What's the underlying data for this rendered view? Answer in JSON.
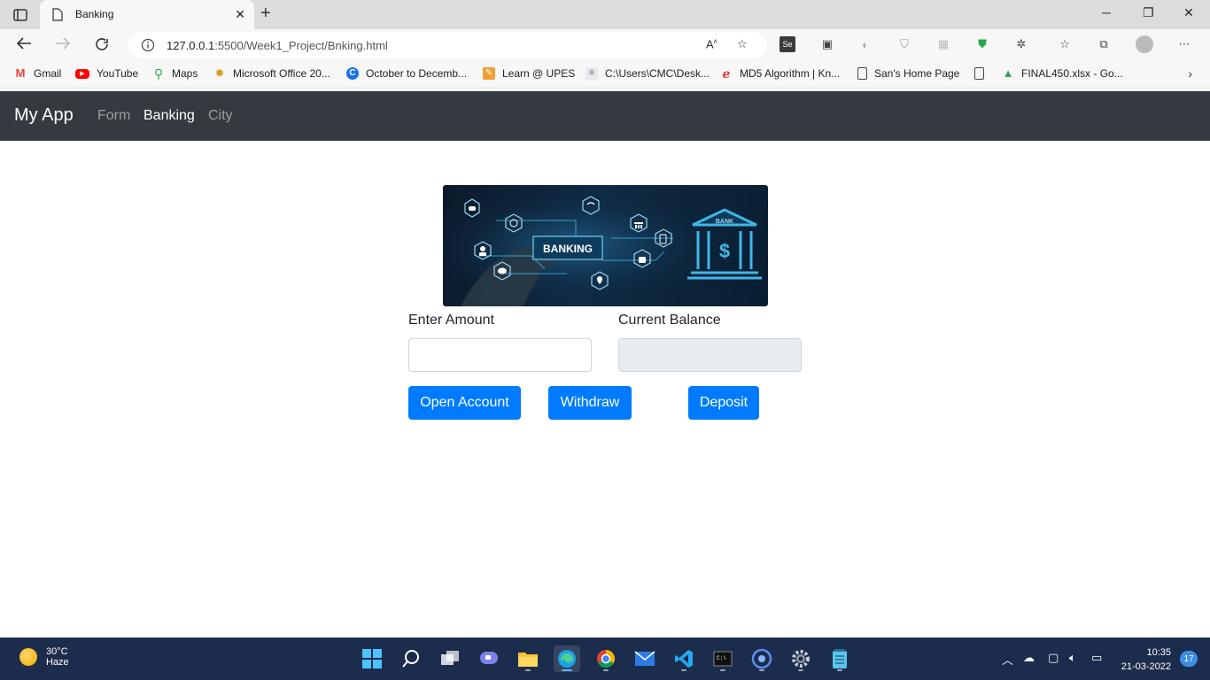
{
  "browser": {
    "tab_title": "Banking",
    "url_host": "127.0.0.1",
    "url_path": ":5500/Week1_Project/Bnking.html",
    "bookmarks": [
      {
        "label": "Gmail",
        "color": "#ea4335"
      },
      {
        "label": "YouTube",
        "color": "#ff0000"
      },
      {
        "label": "Maps",
        "color": "#34a853"
      },
      {
        "label": "Microsoft Office 20...",
        "color": "#d4a017"
      },
      {
        "label": "October to Decemb...",
        "color": "#1a73e8"
      },
      {
        "label": "Learn @ UPES",
        "color": "#f0a030"
      },
      {
        "label": "C:\\Users\\CMC\\Desk...",
        "color": "#9aa0a6"
      },
      {
        "label": "MD5 Algorithm | Kn...",
        "color": "#e53935"
      },
      {
        "label": "San's Home Page",
        "color": "#ffffff"
      },
      {
        "label": "",
        "color": "#ffffff"
      },
      {
        "label": "FINAL450.xlsx - Go...",
        "color": "#34a853"
      }
    ]
  },
  "app": {
    "brand": "My App",
    "nav": [
      {
        "label": "Form",
        "active": false
      },
      {
        "label": "Banking",
        "active": true
      },
      {
        "label": "City",
        "active": false
      }
    ],
    "banner": {
      "main_label": "BANKING",
      "bank_label": "BANK",
      "currency_symbol": "$"
    },
    "amount_label": "Enter Amount",
    "amount_value": "",
    "balance_label": "Current Balance",
    "balance_value": "",
    "buttons": {
      "open_account": "Open Account",
      "withdraw": "Withdraw",
      "deposit": "Deposit"
    },
    "accent_color": "#007bff",
    "navbar_color": "#343a40"
  },
  "taskbar": {
    "temperature": "30°C",
    "weather": "Haze",
    "time": "10:35",
    "date": "21-03-2022",
    "notifications": "17"
  }
}
